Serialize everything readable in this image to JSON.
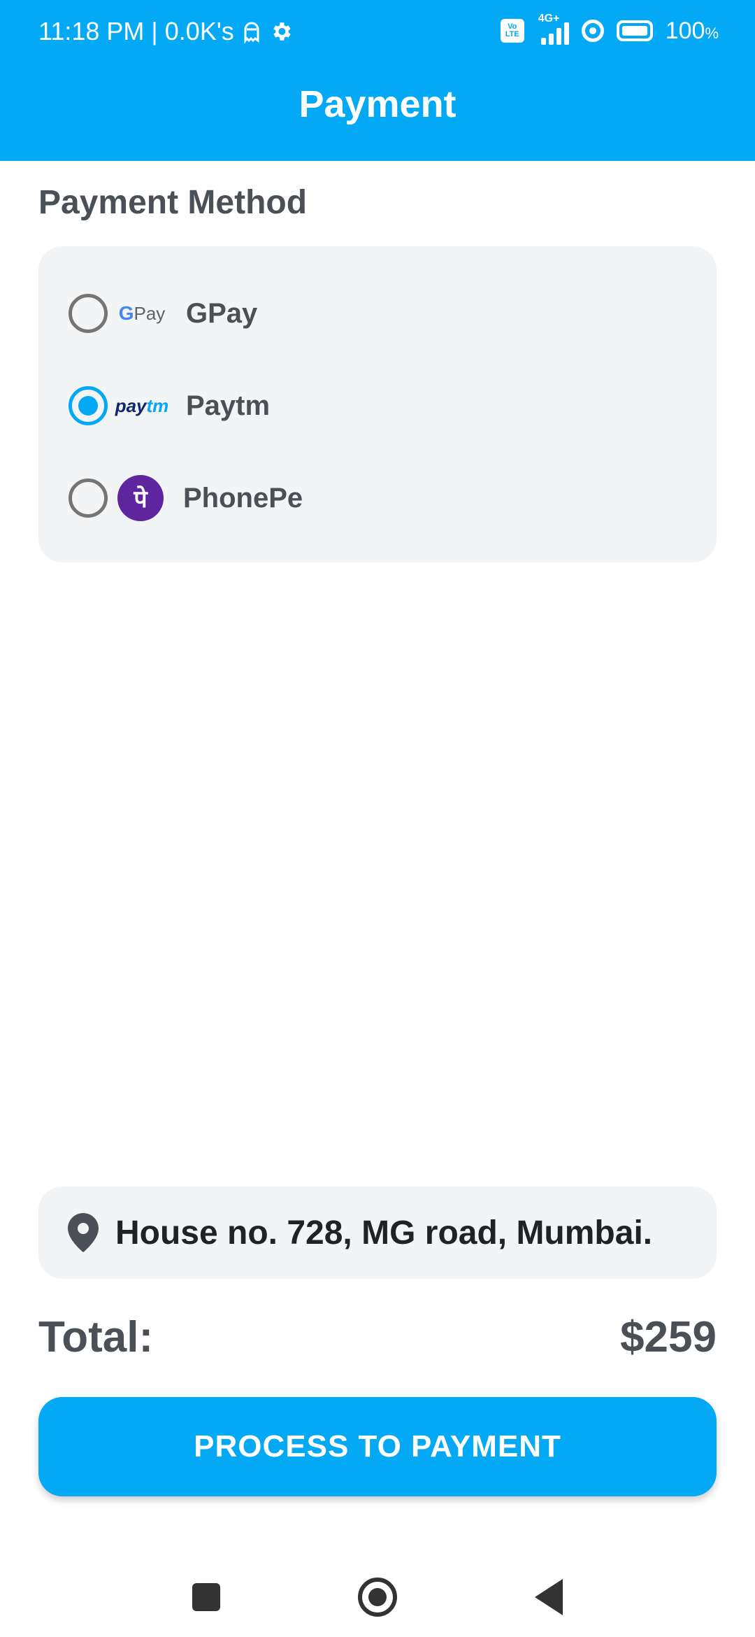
{
  "status_bar": {
    "time_and_speed": "11:18 PM | 0.0K's",
    "volte_top": "Vo",
    "volte_bottom": "LTE",
    "network": "4G+",
    "battery": "100",
    "battery_unit": "%"
  },
  "app_bar": {
    "title": "Payment"
  },
  "payment_section": {
    "title": "Payment Method",
    "methods": [
      {
        "label": "GPay",
        "logo_text": "Pay",
        "logo_g": "G",
        "selected": false
      },
      {
        "label": "Paytm",
        "logo_text": "pay",
        "logo_tm": "tm",
        "selected": true
      },
      {
        "label": "PhonePe",
        "logo_text": "पे",
        "selected": false
      }
    ]
  },
  "address": {
    "text": "House no. 728, MG road, Mumbai."
  },
  "total": {
    "label": "Total:",
    "amount": "$259"
  },
  "action": {
    "label": "PROCESS TO PAYMENT"
  },
  "colors": {
    "primary": "#03a9f4",
    "card_bg": "#f3f4f6",
    "text": "#4b5056",
    "phonepe": "#5f259f"
  },
  "icons": [
    "gear-icon",
    "location-pin-icon",
    "recents-icon",
    "home-icon",
    "back-icon"
  ]
}
